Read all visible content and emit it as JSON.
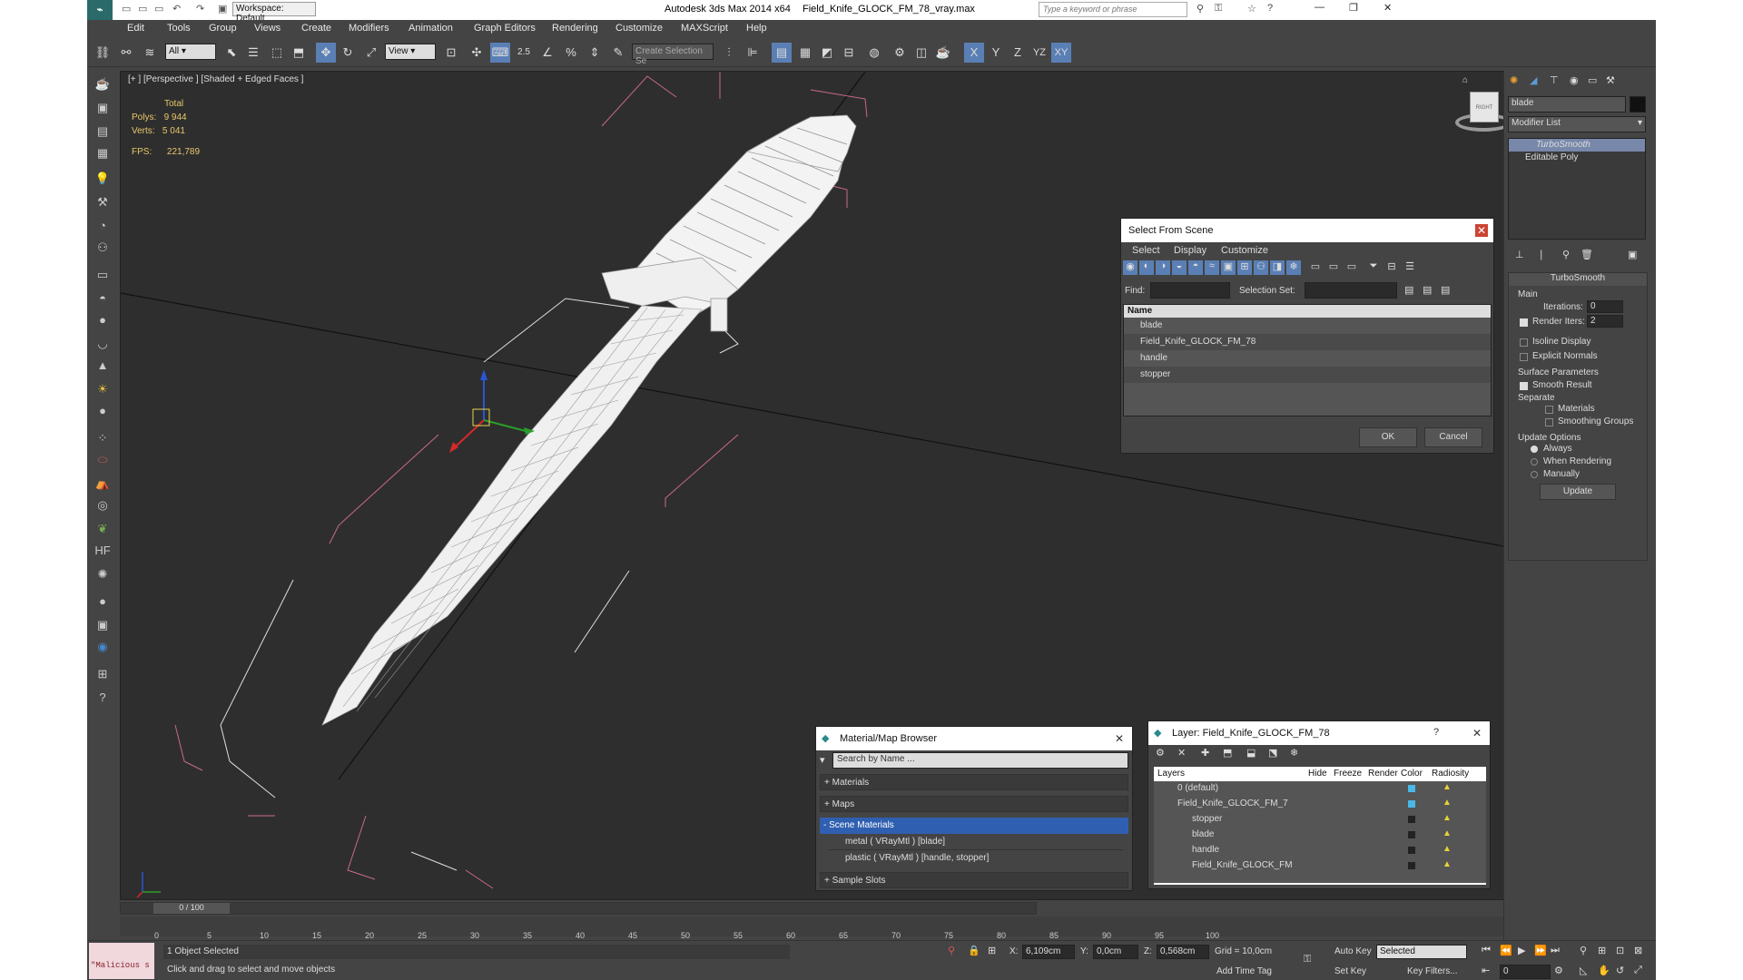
{
  "title_bar": {
    "workspace": "Workspace: Default",
    "app_title": "Autodesk 3ds Max  2014 x64",
    "file_name": "Field_Knife_GLOCK_FM_78_vray.max",
    "search_placeholder": "Type a keyword or phrase"
  },
  "menu": [
    "Edit",
    "Tools",
    "Group",
    "Views",
    "Create",
    "Modifiers",
    "Animation",
    "Graph Editors",
    "Rendering",
    "Customize",
    "MAXScript",
    "Help"
  ],
  "toolbar": {
    "filter_value": "All",
    "coord_value": "View",
    "selection_set_placeholder": "Create Selection Se",
    "axis_x": "X",
    "axis_y": "Y",
    "axis_z": "Z",
    "axis_yz": "YZ",
    "axis_xy": "XY",
    "snap_label": "2.5"
  },
  "viewport": {
    "label": "[+ ] [Perspective ] [Shaded + Edged Faces ]",
    "stats": {
      "total_label": "Total",
      "polys_label": "Polys:",
      "polys_value": "9 944",
      "verts_label": "Verts:",
      "verts_value": "5 041",
      "fps_label": "FPS:",
      "fps_value": "221,789"
    },
    "viewcube_label": "RIGHT"
  },
  "select_dialog": {
    "title": "Select From Scene",
    "tabs": [
      "Select",
      "Display",
      "Customize"
    ],
    "find_label": "Find:",
    "selection_set_label": "Selection Set:",
    "col_name": "Name",
    "items": [
      "blade",
      "Field_Knife_GLOCK_FM_78",
      "handle",
      "stopper"
    ],
    "ok": "OK",
    "cancel": "Cancel"
  },
  "material_browser": {
    "title": "Material/Map Browser",
    "search_placeholder": "Search by Name ...",
    "sections": [
      "+ Materials",
      "+ Maps",
      "- Scene Materials",
      "+ Sample Slots"
    ],
    "materials": [
      "metal  ( VRayMtl ) [blade]",
      "plastic  ( VRayMtl ) [handle, stopper]"
    ]
  },
  "layer_dialog": {
    "title": "Layer: Field_Knife_GLOCK_FM_78",
    "help": "?",
    "columns": [
      "Layers",
      "Hide",
      "Freeze",
      "Render",
      "Color",
      "Radiosity"
    ],
    "rows": [
      "0 (default)",
      "Field_Knife_GLOCK_FM_7",
      "stopper",
      "blade",
      "handle",
      "Field_Knife_GLOCK_FM"
    ]
  },
  "command_panel": {
    "name_value": "blade",
    "modifier_list": "Modifier List",
    "stack": [
      "TurboSmooth",
      "Editable Poly"
    ],
    "rollout_title": "TurboSmooth",
    "main_label": "Main",
    "iterations_label": "Iterations:",
    "iterations_value": "0",
    "render_iters_label": "Render Iters:",
    "render_iters_value": "2",
    "isoline": "Isoline Display",
    "explicit_normals": "Explicit Normals",
    "surface_params": "Surface Parameters",
    "smooth_result": "Smooth Result",
    "separate": "Separate",
    "materials": "Materials",
    "smoothing_groups": "Smoothing Groups",
    "update_options": "Update Options",
    "always": "Always",
    "when_rendering": "When Rendering",
    "manually": "Manually",
    "update_btn": "Update"
  },
  "timeline": {
    "frame": "0 / 100",
    "ticks": [
      "0",
      "5",
      "10",
      "15",
      "20",
      "25",
      "30",
      "35",
      "40",
      "45",
      "50",
      "55",
      "60",
      "65",
      "70",
      "75",
      "80",
      "85",
      "90",
      "95",
      "100"
    ]
  },
  "status": {
    "maxscript": "\"Malicious s",
    "selected": "1 Object Selected",
    "prompt": "Click and drag to select and move objects",
    "x_label": "X:",
    "x_value": "6,109cm",
    "y_label": "Y:",
    "y_value": "0,0cm",
    "z_label": "Z:",
    "z_value": "0,568cm",
    "grid": "Grid = 10,0cm",
    "auto_key": "Auto Key",
    "selected_dropdown": "Selected",
    "set_key": "Set Key",
    "key_filters": "Key Filters...",
    "add_time_tag": "Add Time Tag",
    "frame_value": "0"
  }
}
